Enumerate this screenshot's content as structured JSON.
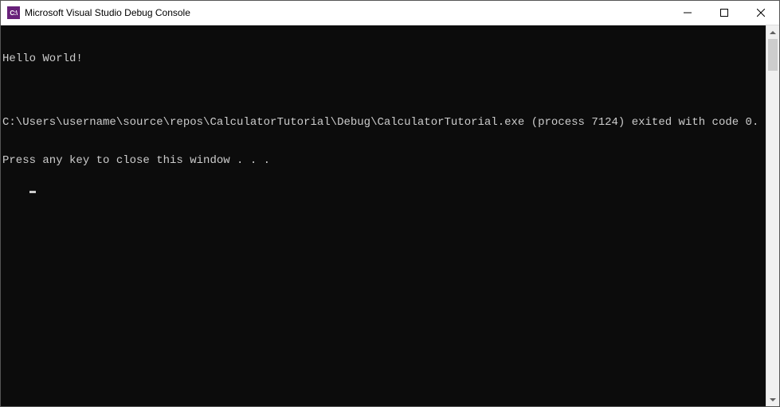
{
  "titlebar": {
    "icon_text": "C:\\",
    "title": "Microsoft Visual Studio Debug Console"
  },
  "console": {
    "lines": [
      "Hello World!",
      "",
      "C:\\Users\\username\\source\\repos\\CalculatorTutorial\\Debug\\CalculatorTutorial.exe (process 7124) exited with code 0.",
      "Press any key to close this window . . ."
    ]
  }
}
